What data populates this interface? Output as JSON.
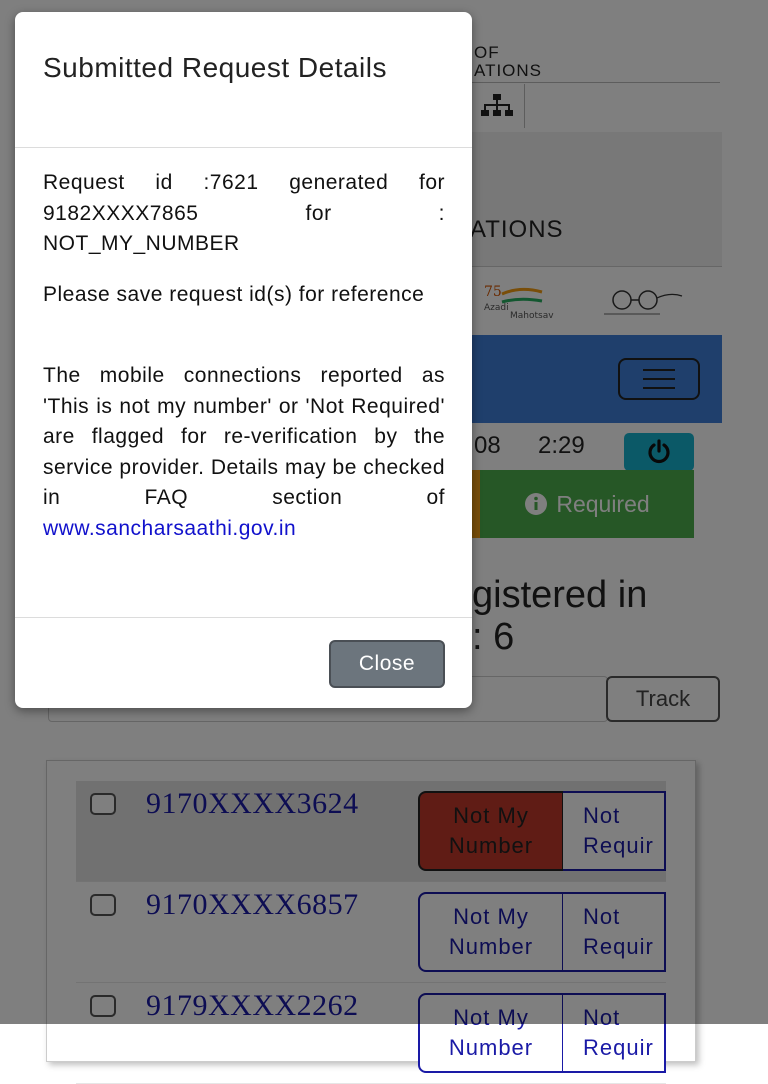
{
  "header": {
    "title_fragment_1": "OF",
    "title_fragment_2": "ATIONS",
    "banner_fragment": "ATIONS"
  },
  "status": {
    "date_fragment": "08",
    "time": "2:29"
  },
  "required_button": {
    "label": "Required"
  },
  "registered": {
    "line1": "gistered in",
    "line2": ": 6"
  },
  "track": {
    "button_label": "Track"
  },
  "numbers": [
    {
      "number": "9170XXXX3624",
      "not_my_number": "Not My Number",
      "nmn_line1": "Not My",
      "nmn_line2": "Number",
      "nr_line1": "Not",
      "nr_line2": "Requir",
      "selected": true
    },
    {
      "number": "9170XXXX6857",
      "not_my_number": "Not My Number",
      "nmn_line1": "Not My",
      "nmn_line2": "Number",
      "nr_line1": "Not",
      "nr_line2": "Requir",
      "selected": false
    },
    {
      "number": "9179XXXX2262",
      "not_my_number": "Not My Number",
      "nmn_line1": "Not My",
      "nmn_line2": "Number",
      "nr_line1": "Not",
      "nr_line2": "Requir",
      "selected": false
    }
  ],
  "logos": {
    "azadi": "Azadi Ka Amrit Mahotsav",
    "azadi_line1": "Azadi",
    "azadi_line2": "Mahotsav",
    "swachh": "Swachh Bharat"
  },
  "modal": {
    "title": "Submitted Request Details",
    "message_1": "Request id :7621 generated for 9182XXXX7865 for : NOT_MY_NUMBER",
    "message_2": "Please save request id(s) for reference",
    "message_3": "The mobile connections reported as 'This is not my number' or 'Not Required' are flagged for re-verification by the service provider. Details may be checked in FAQ section of",
    "link_text": "www.sancharsaathi.gov.in",
    "close_label": "Close"
  },
  "colors": {
    "overlay": "#000000",
    "bluebar": "#3f7fd9",
    "required_green": "#4cae4c",
    "power_cyan": "#17b3cf",
    "selected_red": "#c0392b",
    "number_blue": "#1a1aa6",
    "close_gray": "#6c757d"
  },
  "icons": [
    "sitemap-icon",
    "hamburger-icon",
    "power-icon",
    "info-icon",
    "checkbox-icon"
  ]
}
